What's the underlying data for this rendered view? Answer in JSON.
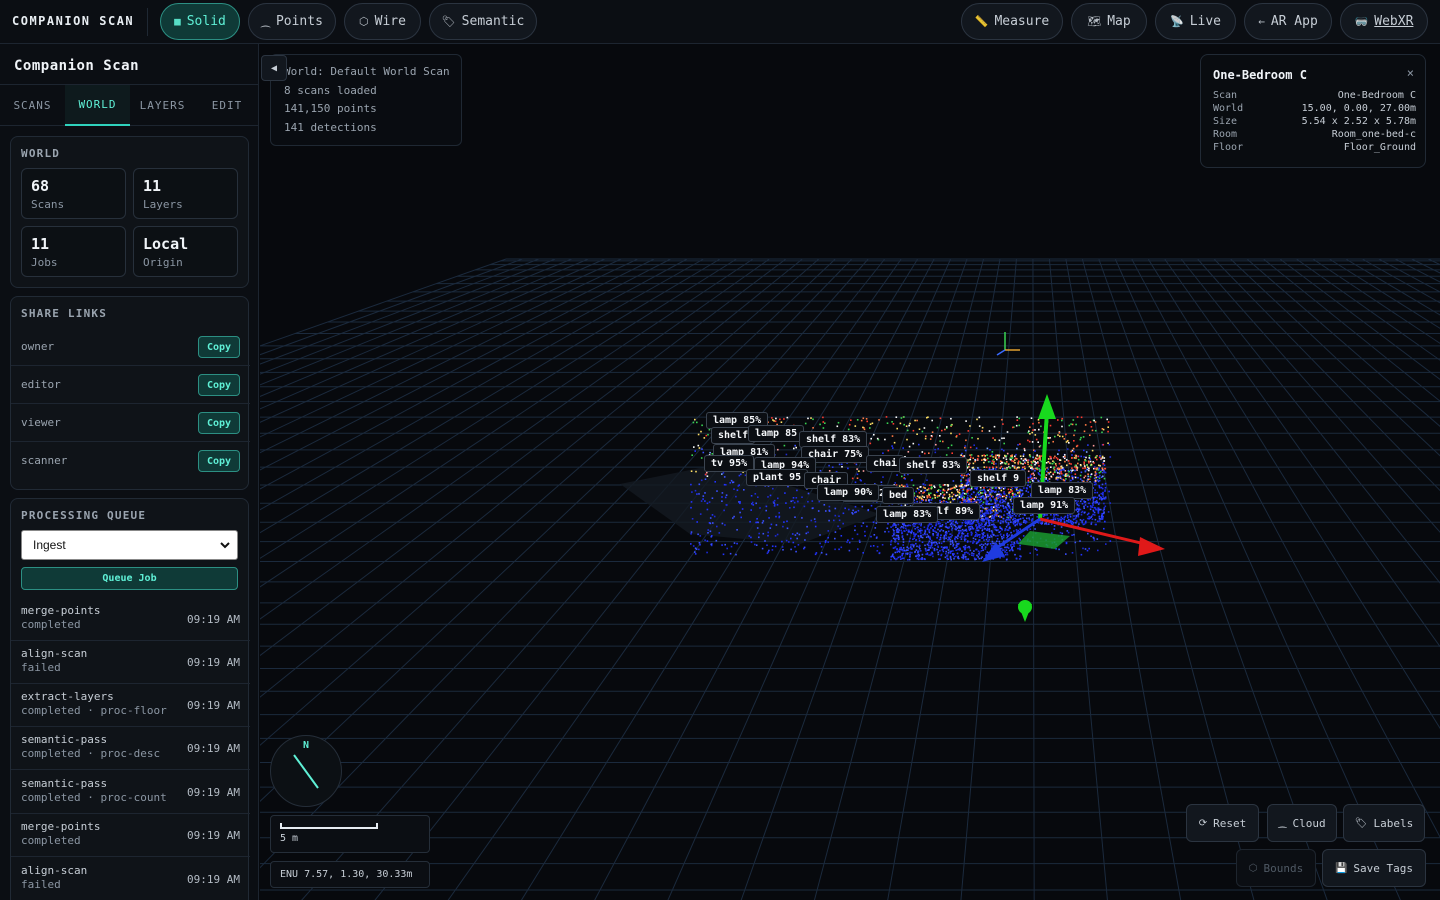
{
  "app": {
    "brand": "COMPANION SCAN"
  },
  "topbar": {
    "modes": [
      {
        "label": "Solid",
        "icon": "■",
        "icon_name": "square-icon",
        "active": true
      },
      {
        "label": "Points",
        "icon": "⁔",
        "icon_name": "points-icon",
        "active": false
      },
      {
        "label": "Wire",
        "icon": "⬡",
        "icon_name": "hexagon-icon",
        "active": false
      },
      {
        "label": "Semantic",
        "icon": "🏷",
        "icon_name": "tag-icon",
        "active": false
      }
    ],
    "tools": [
      {
        "label": "Measure",
        "icon": "📏",
        "icon_name": "ruler-icon"
      },
      {
        "label": "Map",
        "icon": "🗺",
        "icon_name": "map-icon"
      },
      {
        "label": "Live",
        "icon": "📡",
        "icon_name": "antenna-icon"
      },
      {
        "label": "AR App",
        "icon": "←",
        "icon_name": "arrow-left-icon"
      },
      {
        "label": "WebXR",
        "icon": "🥽",
        "icon_name": "headset-icon"
      }
    ]
  },
  "sidebar": {
    "title": "Companion Scan",
    "tabs": [
      "SCANS",
      "WORLD",
      "LAYERS",
      "EDIT"
    ],
    "active_tab": "WORLD",
    "world": {
      "heading": "WORLD",
      "stats": [
        {
          "value": "68",
          "label": "Scans"
        },
        {
          "value": "11",
          "label": "Layers"
        },
        {
          "value": "11",
          "label": "Jobs"
        },
        {
          "value": "Local",
          "label": "Origin"
        }
      ]
    },
    "share": {
      "heading": "SHARE LINKS",
      "copy_label": "Copy",
      "links": [
        "owner",
        "editor",
        "viewer",
        "scanner"
      ]
    },
    "queue": {
      "heading": "PROCESSING QUEUE",
      "selected": "Ingest",
      "queue_button": "Queue Job",
      "jobs": [
        {
          "name": "merge-points",
          "status": "completed",
          "time": "09:19 AM"
        },
        {
          "name": "align-scan",
          "status": "failed",
          "time": "09:19 AM"
        },
        {
          "name": "extract-layers",
          "status": "completed · proc-floor",
          "time": "09:19 AM"
        },
        {
          "name": "semantic-pass",
          "status": "completed · proc-desc",
          "time": "09:19 AM"
        },
        {
          "name": "semantic-pass",
          "status": "completed · proc-count",
          "time": "09:19 AM"
        },
        {
          "name": "merge-points",
          "status": "completed",
          "time": "09:19 AM"
        },
        {
          "name": "align-scan",
          "status": "failed",
          "time": "09:19 AM"
        }
      ]
    }
  },
  "viewport": {
    "info": {
      "collapse_icon": "◀",
      "lines": [
        "World: Default World Scan",
        "8 scans loaded",
        "141,150 points",
        "141 detections"
      ]
    },
    "detail": {
      "title": "One-Bedroom C",
      "close": "×",
      "rows": [
        {
          "key": "Scan",
          "value": "One-Bedroom C"
        },
        {
          "key": "World",
          "value": "15.00, 0.00, 27.00m"
        },
        {
          "key": "Size",
          "value": "5.54 x 2.52 x 5.78m"
        },
        {
          "key": "Room",
          "value": "Room_one-bed-c"
        },
        {
          "key": "Floor",
          "value": "Floor_Ground"
        }
      ]
    },
    "compass_label": "N",
    "scale_label": "5 m",
    "coords": "ENU 7.57, 1.30, 30.33m",
    "buttons": [
      {
        "label": "Reset",
        "icon": "⟳",
        "icon_name": "reset-icon",
        "enabled": true
      },
      {
        "label": "Cloud",
        "icon": "⁔",
        "icon_name": "cloud-icon",
        "enabled": true
      },
      {
        "label": "Labels",
        "icon": "🏷",
        "icon_name": "tag-icon",
        "enabled": true
      },
      {
        "label": "Bounds",
        "icon": "⬡",
        "icon_name": "bounds-icon",
        "enabled": false
      },
      {
        "label": "Save Tags",
        "icon": "💾",
        "icon_name": "save-icon",
        "enabled": true
      }
    ],
    "detections": [
      "lamp 85%",
      "shelf",
      "lamp 85",
      "shelf 83%",
      "lamp 81%",
      "chair 75%",
      "lamp 94%",
      "chai",
      "shelf 83%",
      "tv 95%",
      "plant 95",
      "chair",
      "bed 92%",
      "lamp 90%",
      "bed",
      "shelf 9",
      "lamp 83%",
      "shelf 89%",
      "lamp 91%",
      "lamp 83%"
    ]
  }
}
